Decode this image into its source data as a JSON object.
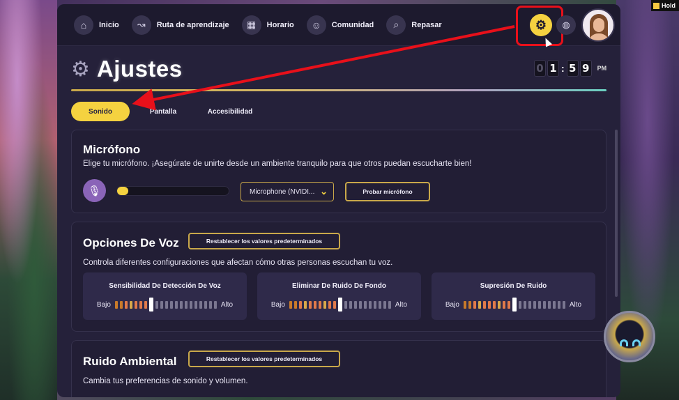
{
  "corner_badge": {
    "label": "Hold"
  },
  "nav": {
    "items": [
      {
        "label": "Inicio",
        "icon": "home-icon",
        "glyph": "⌂"
      },
      {
        "label": "Ruta de aprendizaje",
        "icon": "route-icon",
        "glyph": "↝"
      },
      {
        "label": "Horario",
        "icon": "calendar-icon",
        "glyph": "▦"
      },
      {
        "label": "Comunidad",
        "icon": "community-icon",
        "glyph": "☺"
      },
      {
        "label": "Repasar",
        "icon": "magnifier-icon",
        "glyph": "⌕"
      }
    ],
    "settings_icon": "gear-icon",
    "globe_icon": "globe-icon"
  },
  "header": {
    "title": "Ajustes",
    "clock": {
      "d1": "0",
      "d2": "1",
      "d3": "5",
      "d4": "9",
      "ampm": "PM"
    }
  },
  "tabs": [
    {
      "label": "Sonido",
      "active": true
    },
    {
      "label": "Pantalla",
      "active": false
    },
    {
      "label": "Accesibilidad",
      "active": false
    }
  ],
  "microphone": {
    "title": "Micrófono",
    "description": "Elige tu micrófono. ¡Asegúrate de unirte desde un ambiente tranquilo para que otros puedan escucharte bien!",
    "selected_device": "Microphone (NVIDI...",
    "level": 0.1,
    "test_button": "Probar micrófono"
  },
  "voice_options": {
    "title": "Opciones De Voz",
    "reset_button": "Restablecer los valores predeterminados",
    "description": "Controla diferentes configuraciones que afectan cómo otras personas escuchan tu voz.",
    "sliders": [
      {
        "title": "Sensibilidad De Detección De Voz",
        "low": "Bajo",
        "high": "Alto",
        "value": 7,
        "steps": 20
      },
      {
        "title": "Eliminar De Ruido De Fondo",
        "low": "Bajo",
        "high": "Alto",
        "value": 10,
        "steps": 20
      },
      {
        "title": "Supresión De Ruido",
        "low": "Bajo",
        "high": "Alto",
        "value": 10,
        "steps": 20
      }
    ]
  },
  "ambient_noise": {
    "title": "Ruido Ambiental",
    "reset_button": "Restablecer los valores predeterminados",
    "description": "Cambia tus preferencias de sonido y volumen."
  },
  "colors": {
    "accent": "#f5d240",
    "annotation": "#e8101a",
    "panel": "#25213a"
  }
}
